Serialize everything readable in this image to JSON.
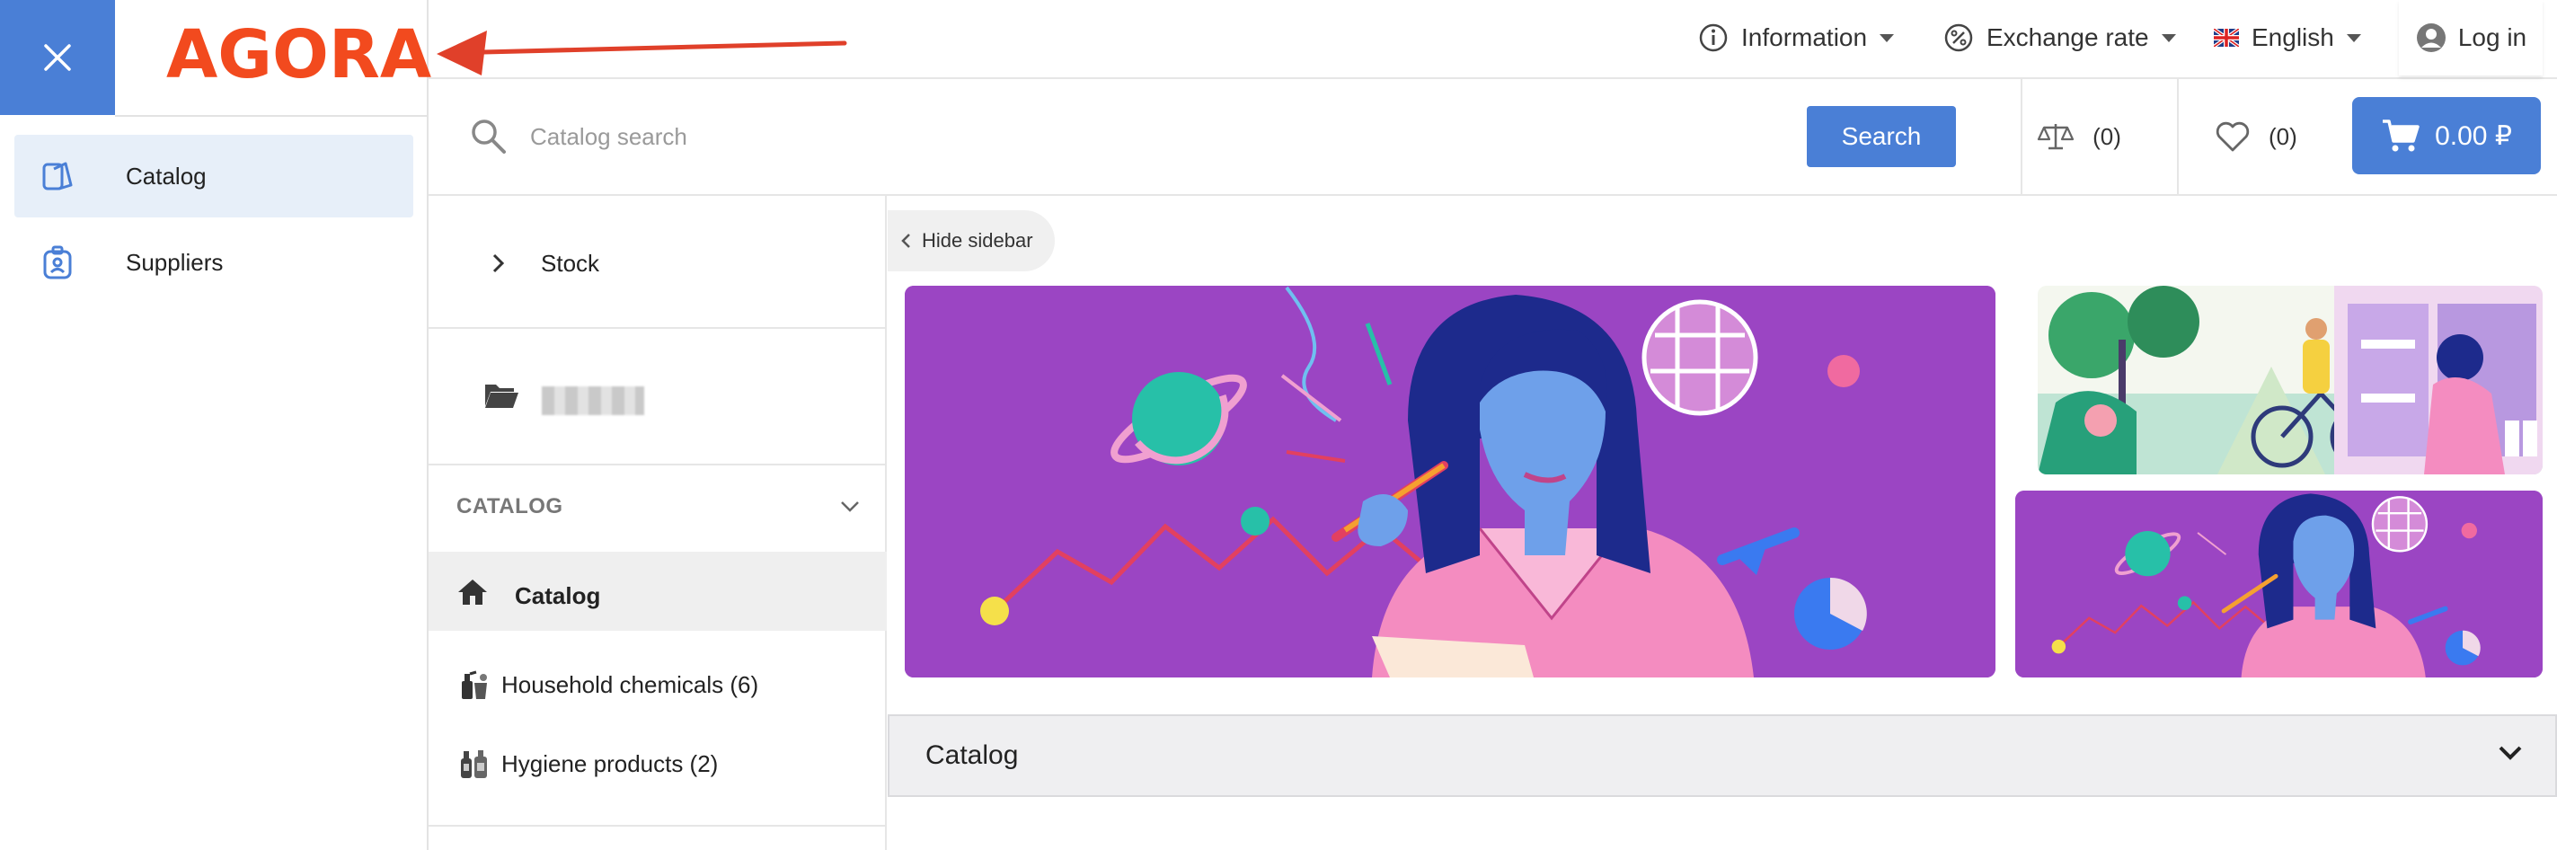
{
  "app": {
    "logo_text": "AGORA",
    "accent_color": "#4a7fd6",
    "logo_color": "#f24a1e"
  },
  "drawer": {
    "close_icon": "close-icon",
    "items": [
      {
        "label": "Catalog",
        "icon": "catalog-icon",
        "active": true
      },
      {
        "label": "Suppliers",
        "icon": "supplier-badge-icon",
        "active": false
      }
    ]
  },
  "header": {
    "information": "Information",
    "exchange_rate": "Exchange rate",
    "language": "English",
    "login": "Log in"
  },
  "search": {
    "placeholder": "Catalog search",
    "button": "Search"
  },
  "counters": {
    "compare": "(0)",
    "favorites": "(0)",
    "cart_total": "0.00 ₽"
  },
  "sidebar": {
    "stock": "Stock",
    "catalog_heading": "CATALOG",
    "active_item": "Catalog",
    "subcategories": [
      {
        "label": "Household chemicals (6)",
        "icon": "household-chemicals-icon"
      },
      {
        "label": "Hygiene products (2)",
        "icon": "hygiene-products-icon"
      }
    ]
  },
  "main": {
    "hide_sidebar": "Hide sidebar",
    "accordion_title": "Catalog"
  }
}
